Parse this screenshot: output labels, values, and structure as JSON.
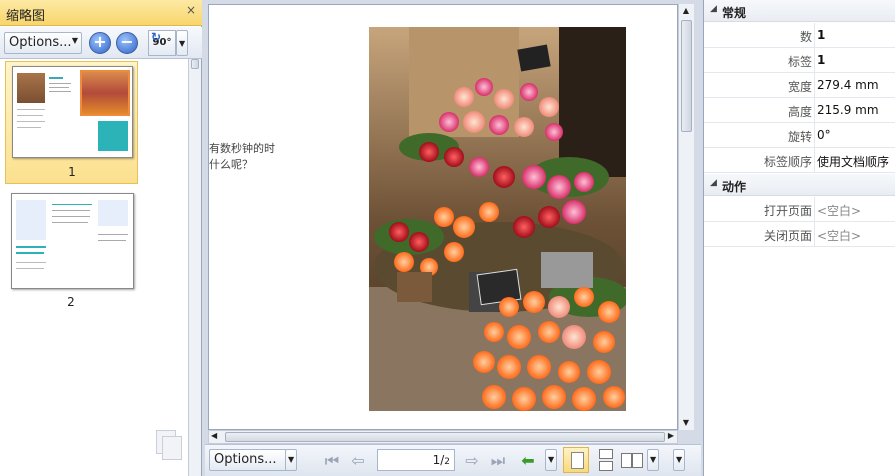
{
  "thumbnails_panel": {
    "title": "缩略图",
    "close": "×",
    "options_label": "Options...",
    "rotate_label": "90°",
    "pages": [
      {
        "number": "1",
        "selected": true
      },
      {
        "number": "2",
        "selected": false
      }
    ]
  },
  "document": {
    "text_lines": [
      "有数秒钟的时",
      "什么呢？"
    ]
  },
  "bottom_toolbar": {
    "options_label": "Options...",
    "page_current": "1",
    "page_total": "2"
  },
  "properties": {
    "general_title": "常规",
    "general_rows": [
      {
        "key": "数",
        "value": "1",
        "bold": true
      },
      {
        "key": "标签",
        "value": "1",
        "bold": true
      },
      {
        "key": "宽度",
        "value": "279.4 mm",
        "bold": false
      },
      {
        "key": "高度",
        "value": "215.9 mm",
        "bold": false
      },
      {
        "key": "旋转",
        "value": "0°",
        "bold": false
      },
      {
        "key": "标签顺序",
        "value": "使用文档顺序",
        "bold": false
      }
    ],
    "actions_title": "动作",
    "action_rows": [
      {
        "key": "打开页面",
        "value": "<空白>"
      },
      {
        "key": "关闭页面",
        "value": "<空白>"
      }
    ]
  },
  "colors": {
    "panel_title_bg": "#f8d66d",
    "selection_bg": "#fbe08e",
    "accent_blue": "#2d62c7"
  }
}
